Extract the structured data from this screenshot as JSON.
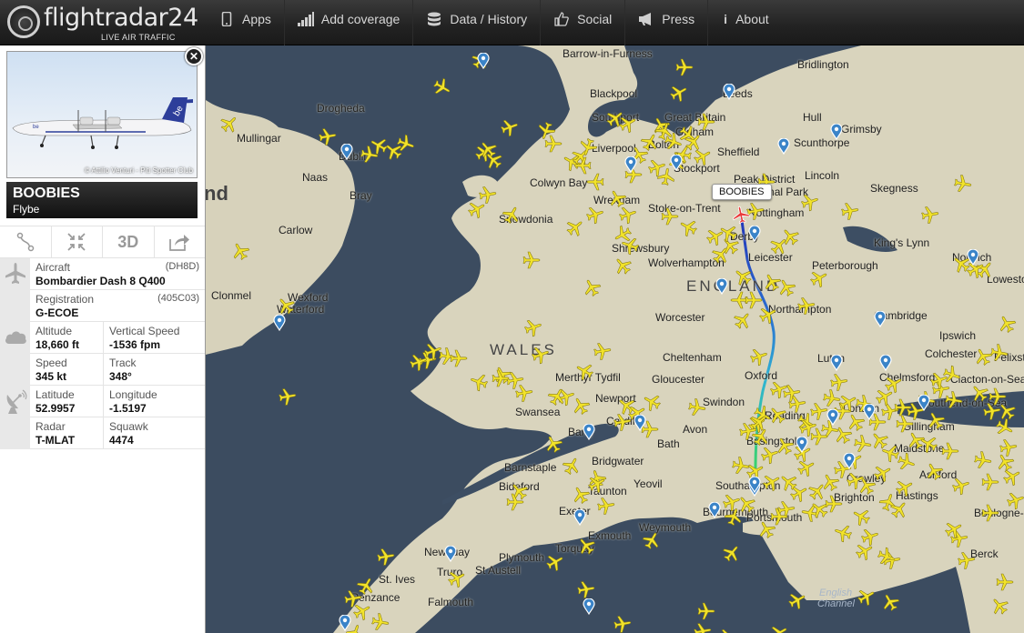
{
  "brand": {
    "name": "flightradar24",
    "tagline": "LIVE AIR TRAFFIC"
  },
  "nav": [
    {
      "label": "Apps",
      "icon": "mobile-icon"
    },
    {
      "label": "Add coverage",
      "icon": "signal-bars-icon"
    },
    {
      "label": "Data / History",
      "icon": "database-icon"
    },
    {
      "label": "Social",
      "icon": "thumbs-up-icon"
    },
    {
      "label": "Press",
      "icon": "megaphone-icon"
    },
    {
      "label": "About",
      "icon": "info-icon"
    }
  ],
  "aircraft_panel": {
    "photo_credit": "© Attilio Venturi - Piti Spotter Club",
    "callsign": "BOOBIES",
    "airline": "Flybe",
    "tools": {
      "view_3d": "3D"
    },
    "aircraft": {
      "label": "Aircraft",
      "value": "Bombardier Dash 8 Q400",
      "code": "(DH8D)"
    },
    "registration": {
      "label": "Registration",
      "value": "G-ECOE",
      "code": "(405C03)"
    },
    "altitude": {
      "label": "Altitude",
      "value": "18,660 ft"
    },
    "vertical_speed": {
      "label": "Vertical Speed",
      "value": "-1536 fpm"
    },
    "speed": {
      "label": "Speed",
      "value": "345 kt"
    },
    "track": {
      "label": "Track",
      "value": "348°"
    },
    "latitude": {
      "label": "Latitude",
      "value": "52.9957"
    },
    "longitude": {
      "label": "Longitude",
      "value": "-1.5197"
    },
    "radar": {
      "label": "Radar",
      "value": "T-MLAT"
    },
    "squawk": {
      "label": "Squawk",
      "value": "4474"
    }
  },
  "map": {
    "selected_flight_tag": "BOOBIES",
    "colors": {
      "land": "#d9d4bd",
      "sea": "#3d4e63",
      "aircraft": "#f2e32a",
      "track_start": "#3ad36a",
      "track_end": "#2233b8"
    },
    "labels": {
      "barrow": "Barrow-in-Furness",
      "bridlington": "Bridlington",
      "blackpool": "Blackpool",
      "leeds": "Leeds",
      "drogheda": "Drogheda",
      "southport": "Southport",
      "great_britain": "Great Britain",
      "hull": "Hull",
      "mullingar": "Mullingar",
      "liverpool": "Liverpool",
      "bolton": "Bolton",
      "oldham": "Oldham",
      "grimsby": "Grimsby",
      "scunthorpe": "Scunthorpe",
      "sheffield": "Sheffield",
      "dublin": "Dublin",
      "naas": "Naas",
      "bray": "Bray",
      "stockport": "Stockport",
      "peak_district": "Peak District",
      "national_park": "National Park",
      "lincoln": "Lincoln",
      "colwyn_bay": "Colwyn Bay",
      "wrexham": "Wrexham",
      "stoke": "Stoke-on-Trent",
      "nottingham": "Nottingham",
      "skegness": "Skegness",
      "snowdonia": "Snowdonia",
      "derby": "Derby",
      "carlow": "Carlow",
      "shrewsbury": "Shrewsbury",
      "kings_lynn": "King's Lynn",
      "norwich": "Norwich",
      "wolverhampton": "Wolverhampton",
      "leicester": "Leicester",
      "peterborough": "Peterborough",
      "lowestoft": "Lowestoft",
      "clonmel": "Clonmel",
      "wexford": "Wexford",
      "england": "ENGLAND",
      "waterford": "Waterford",
      "northampton": "Northampton",
      "worcester": "Worcester",
      "cambridge": "Cambridge",
      "ipswich": "Ipswich",
      "wales": "WALES",
      "cheltenham": "Cheltenham",
      "luton": "Luton",
      "colchester": "Colchester",
      "merthyr": "Merthyr Tydfil",
      "gloucester": "Gloucester",
      "oxford": "Oxford",
      "chelmsford": "Chelmsford",
      "clacton": "Clacton-on-Sea",
      "felixstowe": "Felixstowe",
      "newport": "Newport",
      "swindon": "Swindon",
      "southend": "Southend-on-Sea",
      "swansea": "Swansea",
      "cardiff": "Cardiff",
      "reading": "Reading",
      "london": "London",
      "barry": "Barry",
      "avon": "Avon",
      "bath": "Bath",
      "basingstoke": "Basingstoke",
      "gillingham": "Gillingham",
      "maidstone": "Maidstone",
      "bridgwater": "Bridgwater",
      "ashford": "Ashford",
      "barnstaple": "Barnstaple",
      "bideford": "Bideford",
      "taunton": "Taunton",
      "yeovil": "Yeovil",
      "southampton": "Southampton",
      "hastings": "Hastings",
      "crawley": "Crawley",
      "brighton": "Brighton",
      "exeter": "Exeter",
      "bournemouth": "Bournemouth",
      "portsmouth": "Portsmouth",
      "weymouth": "Weymouth",
      "boulogne": "Boulogne-sur-",
      "exmouth": "Exmouth",
      "berck": "Berck",
      "newquay": "Newquay",
      "torquay": "Torquay",
      "plymouth": "Plymouth",
      "truro": "Truro",
      "st_austell": "St Austell",
      "st_ives": "St. Ives",
      "penzance": "Penzance",
      "falmouth": "Falmouth",
      "english_channel": "English",
      "english_channel2": "Channel",
      "ireland": "nd"
    }
  }
}
